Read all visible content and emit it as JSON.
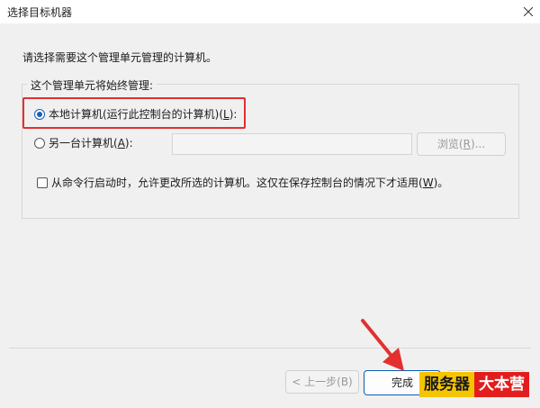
{
  "window": {
    "title": "选择目标机器"
  },
  "prompt": "请选择需要这个管理单元管理的计算机。",
  "group": {
    "legend": "这个管理单元将始终管理:",
    "local": {
      "label_main": "本地计算机(运行此控制台的计算机)(",
      "accel": "L",
      "label_end": "):",
      "selected": true
    },
    "other": {
      "label_main": "另一台计算机(",
      "accel": "A",
      "label_end": "):",
      "selected": false,
      "value": ""
    },
    "browse": {
      "label_main": "浏览(",
      "accel": "R",
      "label_end": ")..."
    },
    "commandline": {
      "label_main": "从命令行启动时，允许更改所选的计算机。这仅在保存控制台的情况下才适用(",
      "accel": "W",
      "label_end": ")。",
      "checked": false
    }
  },
  "footer": {
    "prev_label": "< 上一步(B)",
    "finish_label": "完成"
  },
  "watermark": {
    "part1": "服务器",
    "part2": "大本营"
  },
  "colors": {
    "highlight": "#e3302f",
    "accent": "#1a5fb4",
    "watermark_yellow": "#f5c400",
    "watermark_red": "#e31d1d"
  }
}
